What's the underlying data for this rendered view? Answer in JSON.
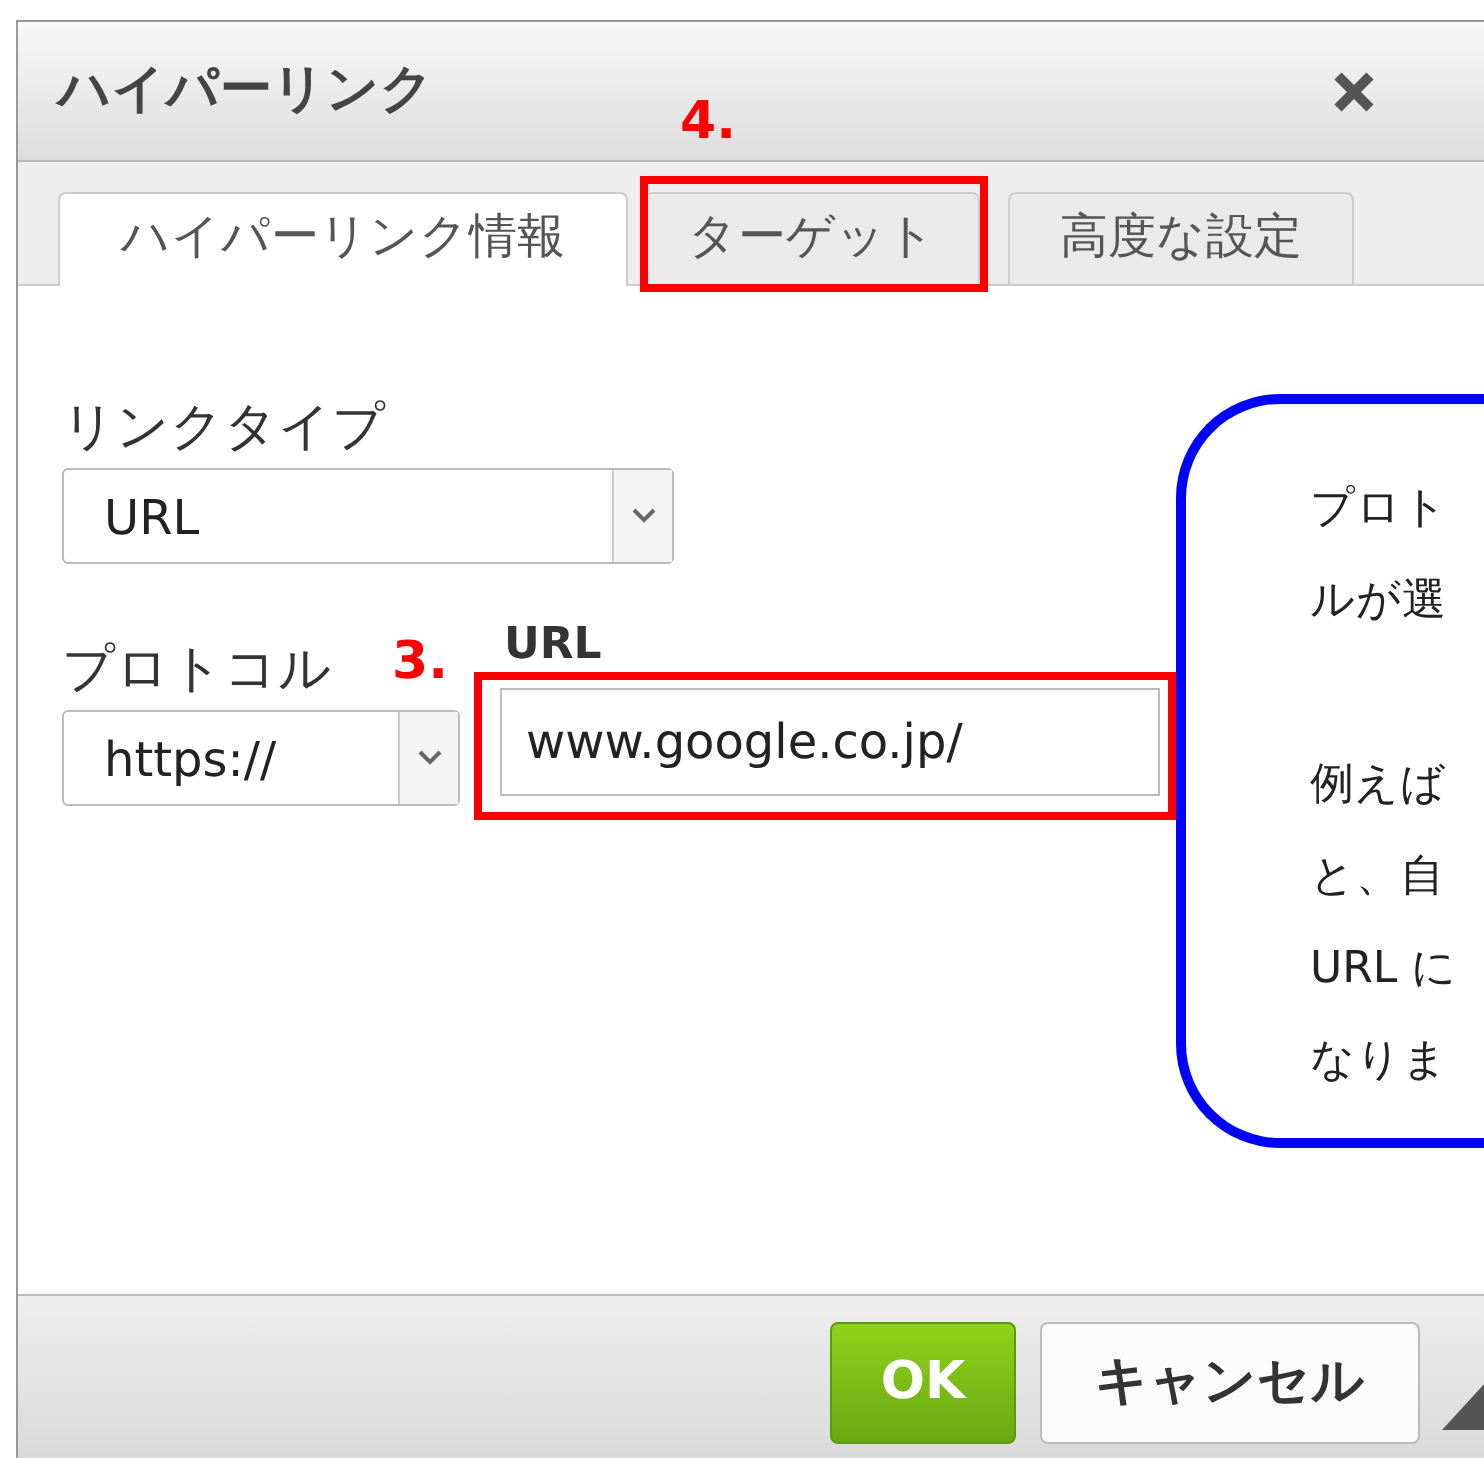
{
  "dialog": {
    "title": "ハイパーリンク"
  },
  "tabs": [
    {
      "label": "ハイパーリンク情報",
      "selected": true
    },
    {
      "label": "ターゲット",
      "selected": false
    },
    {
      "label": "高度な設定",
      "selected": false
    }
  ],
  "link_type": {
    "label": "リンクタイプ",
    "value": "URL"
  },
  "protocol": {
    "label": "プロトコル",
    "value": "https://"
  },
  "url": {
    "label": "URL",
    "value": "www.google.co.jp/"
  },
  "annotations": [
    {
      "label": "3."
    },
    {
      "label": "4."
    }
  ],
  "callout": {
    "paragraphs": [
      [
        "プロト",
        "ルが選"
      ],
      [
        "例えば",
        "と、自",
        "URL に",
        "なりま"
      ]
    ]
  },
  "buttons": [
    {
      "label": "OK",
      "kind": "primary"
    },
    {
      "label": "キャンセル",
      "kind": "secondary"
    }
  ]
}
